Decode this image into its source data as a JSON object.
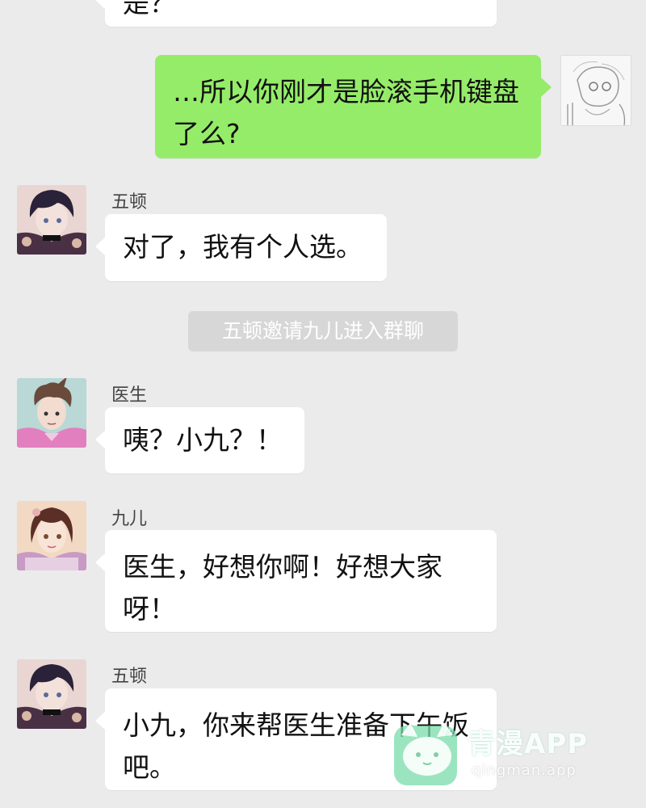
{
  "chat": {
    "top_partial_text": "是？",
    "messages": [
      {
        "type": "outgoing",
        "text": "…所以你刚才是脸滚手机键盘了么?",
        "avatar_icon": "sketch-character-avatar"
      },
      {
        "type": "incoming",
        "sender": "五顿",
        "text": "对了，我有个人选。",
        "avatar_icon": "dark-hair-character-avatar"
      },
      {
        "type": "system",
        "text": "五顿邀请九儿进入群聊"
      },
      {
        "type": "incoming",
        "sender": "医生",
        "text": "咦？小九？！",
        "avatar_icon": "doctor-character-avatar"
      },
      {
        "type": "incoming",
        "sender": "九儿",
        "text": "医生，好想你啊！好想大家呀！",
        "avatar_icon": "girl-character-avatar"
      },
      {
        "type": "incoming",
        "sender": "五顿",
        "text": "小九，你来帮医生准备下午饭吧。",
        "avatar_icon": "dark-hair-character-avatar"
      }
    ]
  },
  "watermark": {
    "title": "青漫APP",
    "url": "qingman.app",
    "logo_icon": "cat-face-logo-icon"
  },
  "colors": {
    "background": "#ebebeb",
    "outgoing_bubble": "#95ec69",
    "incoming_bubble": "#ffffff",
    "system_bubble": "#d7d7d7"
  }
}
